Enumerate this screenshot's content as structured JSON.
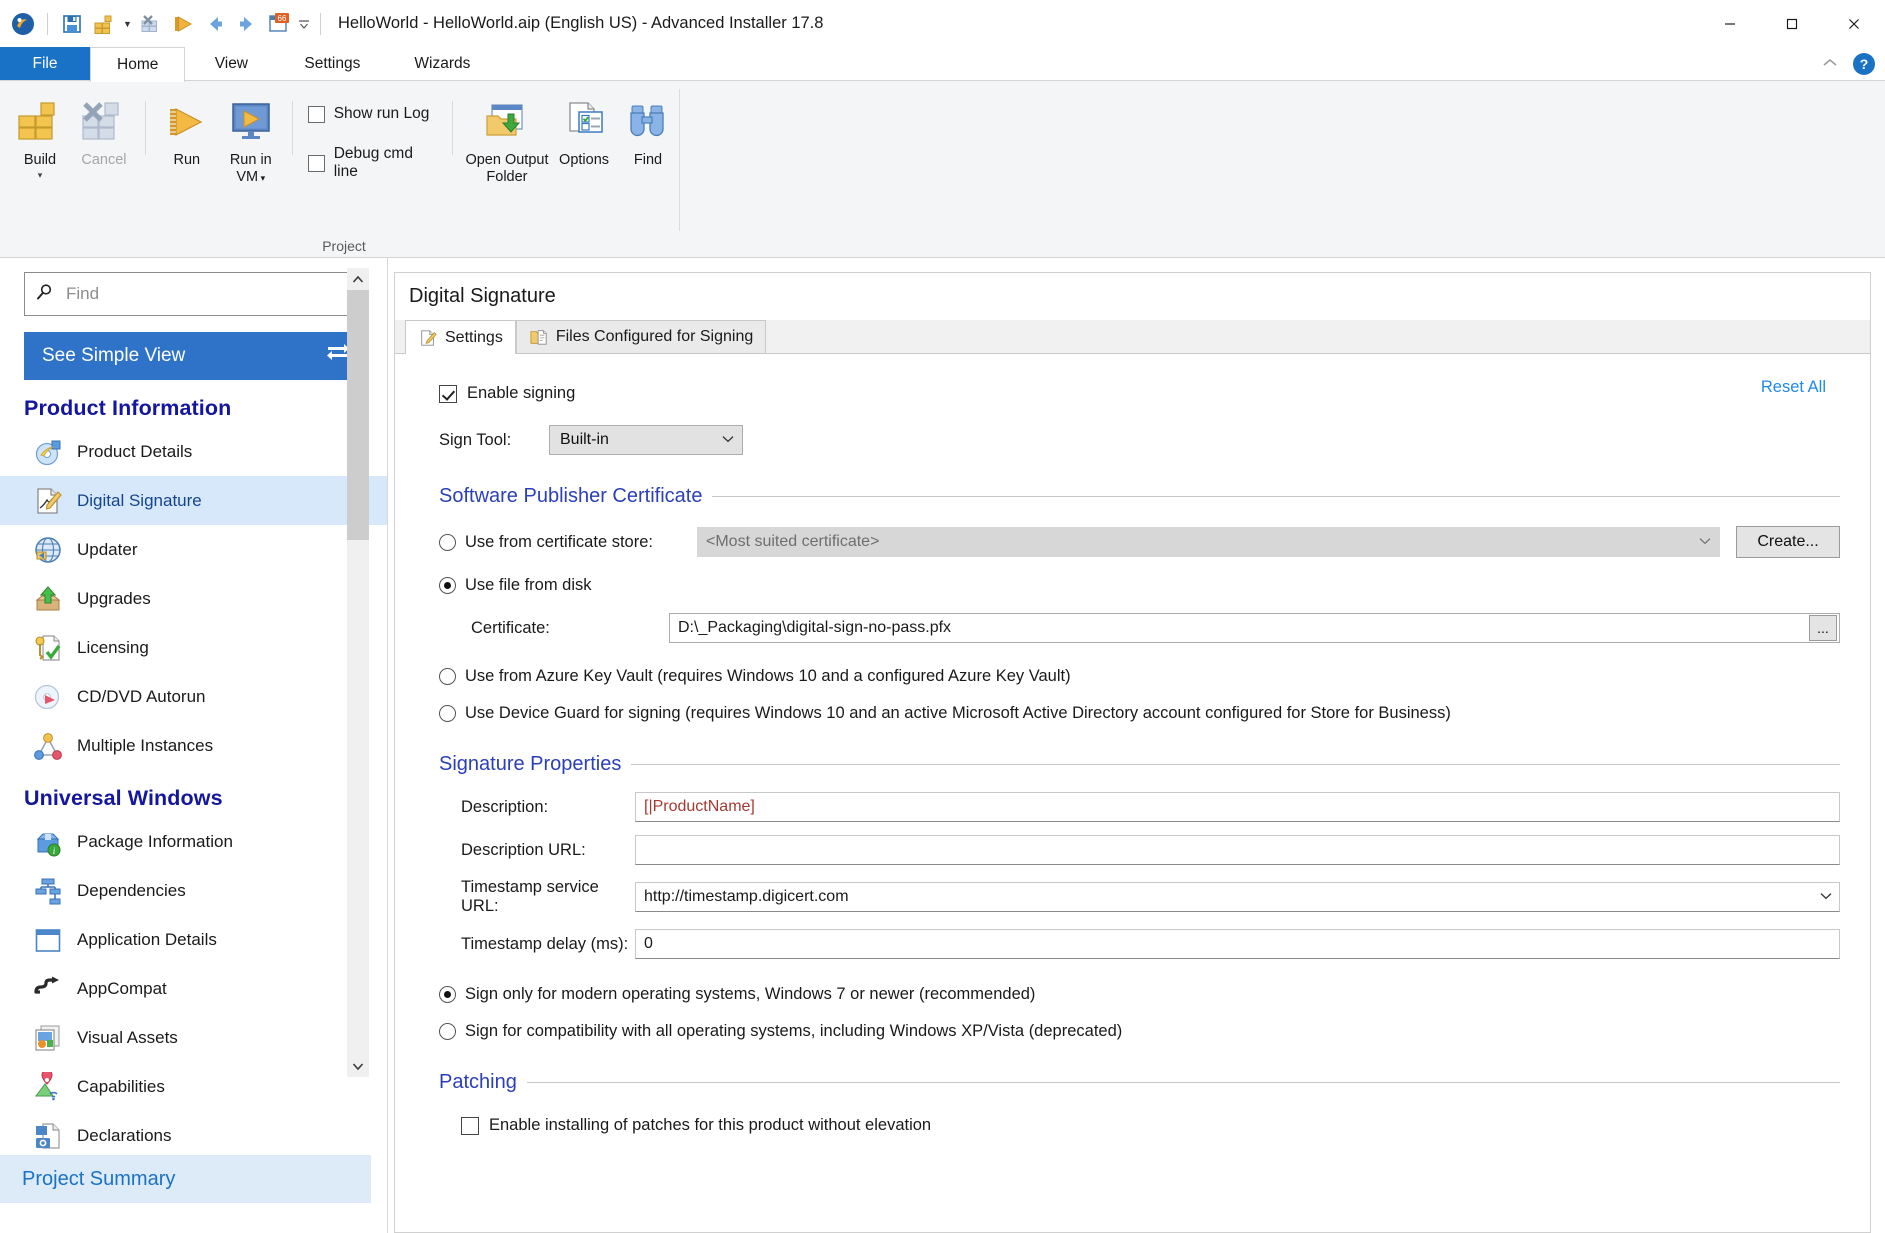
{
  "window": {
    "title": "HelloWorld - HelloWorld.aip (English US) - Advanced Installer 17.8",
    "minimize": "—",
    "maximize": "▢",
    "close": "✕",
    "collapse_ribbon": "⌃",
    "help": "?"
  },
  "quick_access": [
    {
      "name": "app-logo-icon",
      "label": "Advanced Installer"
    },
    {
      "name": "save-icon",
      "label": "Save"
    },
    {
      "name": "build-icon",
      "label": "Build"
    },
    {
      "name": "build-dropdown-arrow",
      "label": "▾"
    },
    {
      "name": "package-icon",
      "label": "Package"
    },
    {
      "name": "run-icon",
      "label": "Run"
    },
    {
      "name": "back-arrow-icon",
      "label": "Back"
    },
    {
      "name": "forward-arrow-icon",
      "label": "Forward"
    },
    {
      "name": "notifications-icon",
      "label": "66"
    },
    {
      "name": "customize-qat-arrow",
      "label": "▾"
    }
  ],
  "ribbon": {
    "tabs": [
      {
        "id": "file",
        "label": "File",
        "active": false,
        "is_file": true
      },
      {
        "id": "home",
        "label": "Home",
        "active": true,
        "is_file": false
      },
      {
        "id": "view",
        "label": "View",
        "active": false,
        "is_file": false
      },
      {
        "id": "settings",
        "label": "Settings",
        "active": false,
        "is_file": false
      },
      {
        "id": "wizards",
        "label": "Wizards",
        "active": false,
        "is_file": false
      }
    ],
    "group_label": "Project",
    "buttons": {
      "build": "Build",
      "build_dropdown": "▾",
      "cancel": "Cancel",
      "run": "Run",
      "run_in_vm_line1": "Run in",
      "run_in_vm_line2": "VM",
      "run_in_vm_dropdown": "▾",
      "open_output_folder_line1": "Open Output",
      "open_output_folder_line2": "Folder",
      "options": "Options",
      "find": "Find"
    },
    "checkboxes": [
      {
        "label": "Show run Log",
        "checked": false
      },
      {
        "label": "Debug cmd line",
        "checked": false
      }
    ]
  },
  "sidebar": {
    "find_placeholder": "Find",
    "find_value": "",
    "simple_view_label": "See Simple View",
    "simple_view_icon": "⇄",
    "project_summary": "Project Summary",
    "sections": [
      {
        "title": "Product Information",
        "items": [
          {
            "label": "Product Details",
            "icon": "product-details-icon",
            "selected": false
          },
          {
            "label": "Digital Signature",
            "icon": "digital-signature-icon",
            "selected": true
          },
          {
            "label": "Updater",
            "icon": "updater-icon",
            "selected": false
          },
          {
            "label": "Upgrades",
            "icon": "upgrades-icon",
            "selected": false
          },
          {
            "label": "Licensing",
            "icon": "licensing-icon",
            "selected": false
          },
          {
            "label": "CD/DVD Autorun",
            "icon": "cd-dvd-autorun-icon",
            "selected": false
          },
          {
            "label": "Multiple Instances",
            "icon": "multiple-instances-icon",
            "selected": false
          }
        ]
      },
      {
        "title": "Universal Windows",
        "items": [
          {
            "label": "Package Information",
            "icon": "package-information-icon",
            "selected": false
          },
          {
            "label": "Dependencies",
            "icon": "dependencies-icon",
            "selected": false
          },
          {
            "label": "Application Details",
            "icon": "application-details-icon",
            "selected": false
          },
          {
            "label": "AppCompat",
            "icon": "appcompat-icon",
            "selected": false
          },
          {
            "label": "Visual Assets",
            "icon": "visual-assets-icon",
            "selected": false
          },
          {
            "label": "Capabilities",
            "icon": "capabilities-icon",
            "selected": false
          },
          {
            "label": "Declarations",
            "icon": "declarations-icon",
            "selected": false
          }
        ]
      }
    ]
  },
  "page": {
    "title": "Digital Signature",
    "tabs": [
      {
        "label": "Settings",
        "icon": "settings-tab-icon",
        "active": true
      },
      {
        "label": "Files Configured for Signing",
        "icon": "files-tab-icon",
        "active": false
      }
    ],
    "reset_all": "Reset All",
    "enable_signing": {
      "label": "Enable signing",
      "checked": true
    },
    "sign_tool": {
      "label": "Sign Tool:",
      "value": "Built-in",
      "arrow": "⌄"
    },
    "publisher_certificate": {
      "group_title": "Software Publisher Certificate",
      "option_store": {
        "label": "Use from certificate store:",
        "selected": false
      },
      "store_combo_value": "<Most suited certificate>",
      "store_combo_arrow": "⌄",
      "create_button": "Create...",
      "option_disk": {
        "label": "Use file from disk",
        "selected": true
      },
      "certificate_label": "Certificate:",
      "certificate_value": "D:\\_Packaging\\digital-sign-no-pass.pfx",
      "browse_button": "...",
      "option_azure": {
        "label": "Use from Azure Key Vault (requires Windows 10 and a configured Azure Key Vault)",
        "selected": false
      },
      "option_device_guard": {
        "label": "Use Device Guard for signing (requires Windows 10 and an active Microsoft Active Directory account configured for Store for Business)",
        "selected": false
      }
    },
    "signature_properties": {
      "group_title": "Signature Properties",
      "fields": [
        {
          "label": "Description:",
          "value": "[|ProductName]",
          "style": "red",
          "type": "text"
        },
        {
          "label": "Description URL:",
          "value": "",
          "style": "normal",
          "type": "text"
        },
        {
          "label": "Timestamp service URL:",
          "value": "http://timestamp.digicert.com",
          "style": "normal",
          "type": "combo"
        },
        {
          "label": "Timestamp delay (ms):",
          "value": "0",
          "style": "normal",
          "type": "text"
        }
      ],
      "option_modern": {
        "label": "Sign only for modern operating systems, Windows 7 or newer (recommended)",
        "selected": true
      },
      "option_compat": {
        "label": "Sign for compatibility with all operating systems, including Windows XP/Vista (deprecated)",
        "selected": false
      }
    },
    "patching": {
      "group_title": "Patching",
      "checkbox": {
        "label": "Enable installing of patches for this product without elevation",
        "checked": false
      }
    }
  },
  "colors": {
    "accent_blue": "#2f73c8",
    "file_tab_blue": "#1a72c6",
    "section_heading": "#14179e",
    "group_heading": "#2b3fb8",
    "link_blue": "#2389e8",
    "selected_row": "#d6e8fa",
    "red_text": "#a33a33"
  }
}
